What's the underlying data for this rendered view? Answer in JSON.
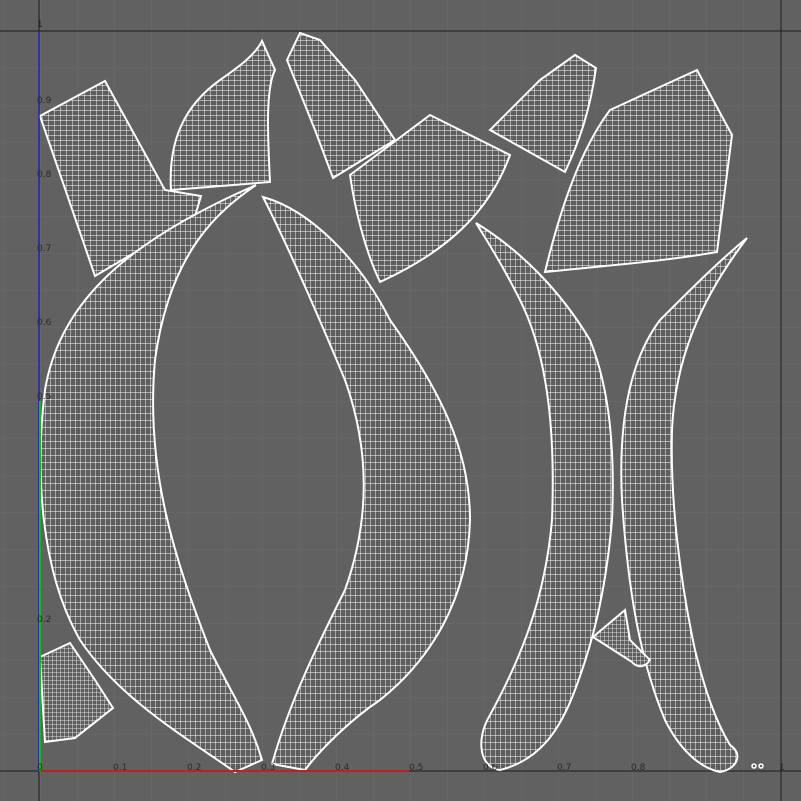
{
  "viewport": {
    "title": "",
    "colors": {
      "background": "#616161",
      "grid_minor": "#6a6a6a",
      "grid_major": "#555555",
      "u_axis": "#c02020",
      "v_axis": "#2020c0",
      "v_axis_partial": "#20b020",
      "uv_wire": "#ffffff",
      "frame": "#1a1a1a"
    }
  },
  "axis_labels": {
    "u": [
      "0",
      "0.1",
      "0.2",
      "0.3",
      "0.4",
      "0.5",
      "0.6",
      "0.7",
      "0.8",
      "1"
    ],
    "v": [
      "1",
      "0.9",
      "0.8",
      "0.7",
      "0.6",
      "0.5",
      "0.2"
    ]
  },
  "uv_islands": [
    {
      "name": "uv-island-top-left-block"
    },
    {
      "name": "uv-island-top-fan-left"
    },
    {
      "name": "uv-island-top-tall-block"
    },
    {
      "name": "uv-island-top-center-block"
    },
    {
      "name": "uv-island-top-right-small"
    },
    {
      "name": "uv-island-top-right-large"
    },
    {
      "name": "uv-island-horn-left"
    },
    {
      "name": "uv-island-horn-center"
    },
    {
      "name": "uv-island-tusk-right-a"
    },
    {
      "name": "uv-island-tusk-right-b"
    },
    {
      "name": "uv-island-bottom-left-small"
    },
    {
      "name": "uv-island-small-cone"
    },
    {
      "name": "uv-island-dots"
    }
  ]
}
